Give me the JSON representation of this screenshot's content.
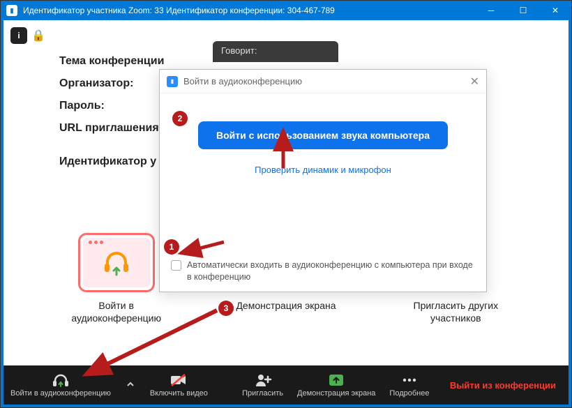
{
  "titlebar": {
    "text": "Идентификатор участника Zoom: 33   Идентификатор конференции: 304-467-789"
  },
  "speaking": {
    "label": "Говорит:"
  },
  "meeting": {
    "topic_label": "Тема конференции",
    "host_label": "Организатор:",
    "password_label": "Пароль:",
    "url_label": "URL приглашения",
    "id_label": "Идентификатор у"
  },
  "tiles": {
    "join_audio": "Войти в аудиоконференцию",
    "share_screen": "Демонстрация экрана",
    "invite": "Пригласить других участников"
  },
  "toolbar": {
    "join_audio": "Войти в аудиоконференцию",
    "video": "Включить видео",
    "invite": "Пригласить",
    "share": "Демонстрация экрана",
    "more": "Подробнее",
    "leave": "Выйти из конференции"
  },
  "modal": {
    "title": "Войти в аудиоконференцию",
    "primary_button": "Войти с использованием звука компьютера",
    "test_link": "Проверить динамик и микрофон",
    "auto_join": "Автоматически входить в аудиоконференцию с компьютера при входе в конференцию"
  },
  "markers": {
    "m1": "1",
    "m2": "2",
    "m3": "3"
  }
}
